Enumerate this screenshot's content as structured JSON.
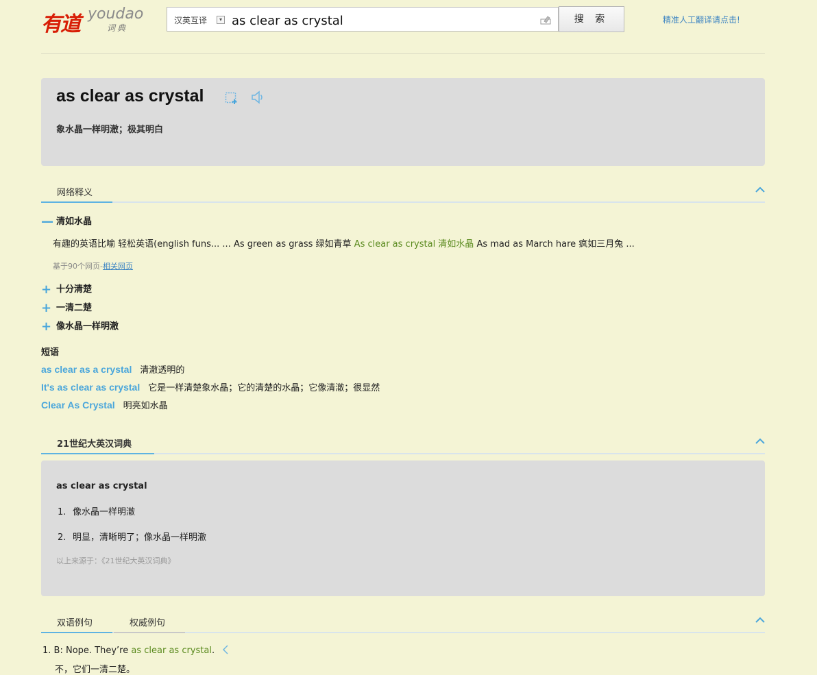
{
  "logo": {
    "cn": "有道",
    "en": "youdao",
    "sub": "词典"
  },
  "search": {
    "mode": "汉英互译",
    "query": "as clear as crystal",
    "button": "搜 索"
  },
  "human_translation_link": "精准人工翻译请点击!",
  "entry": {
    "word": "as clear as crystal",
    "translation": "象水晶一样明澈；极其明白"
  },
  "web_section": {
    "tab": "网络释义",
    "items": [
      {
        "sign": "—",
        "label": "清如水晶",
        "detail_before": "有趣的英语比喻 轻松英语(english funs... ... As green as grass 绿如青草 ",
        "detail_highlight": "As clear as crystal 清如水晶",
        "detail_after": " As mad as March hare 疯如三月兔 ...",
        "source_prefix": "基于90个网页-",
        "source_link": "相关网页"
      },
      {
        "sign": "+",
        "label": "十分清楚"
      },
      {
        "sign": "+",
        "label": "一清二楚"
      },
      {
        "sign": "+",
        "label": "像水晶一样明澈"
      }
    ]
  },
  "phrases": {
    "title": "短语",
    "items": [
      {
        "phrase": "as clear as a crystal",
        "meaning": "清澈透明的"
      },
      {
        "phrase": "It's as clear as crystal",
        "meaning": "它是一样清楚象水晶；它的清楚的水晶；它像清澈；很显然"
      },
      {
        "phrase": "Clear As Crystal",
        "meaning": "明亮如水晶"
      }
    ]
  },
  "dict21": {
    "tab": "21世纪大英汉词典",
    "word": "as clear as crystal",
    "definitions": [
      {
        "num": "1.",
        "text": "像水晶一样明澈"
      },
      {
        "num": "2.",
        "text": "明显，清晰明了；像水晶一样明澈"
      }
    ],
    "source": "以上来源于：《21世纪大英汉词典》"
  },
  "examples": {
    "tabs": [
      "双语例句",
      "权威例句"
    ],
    "items": [
      {
        "num": "1.",
        "before": "B: Nope. They’re ",
        "highlight": "as clear as crystal",
        "after": ".",
        "translation": "不，它们一清二楚。"
      }
    ]
  },
  "colors": {
    "background": "#f4f4d5",
    "card": "#dcdcdc",
    "accent_blue": "#4aa6db",
    "highlight_green": "#5a8a1e",
    "logo_red": "#d81e06"
  }
}
